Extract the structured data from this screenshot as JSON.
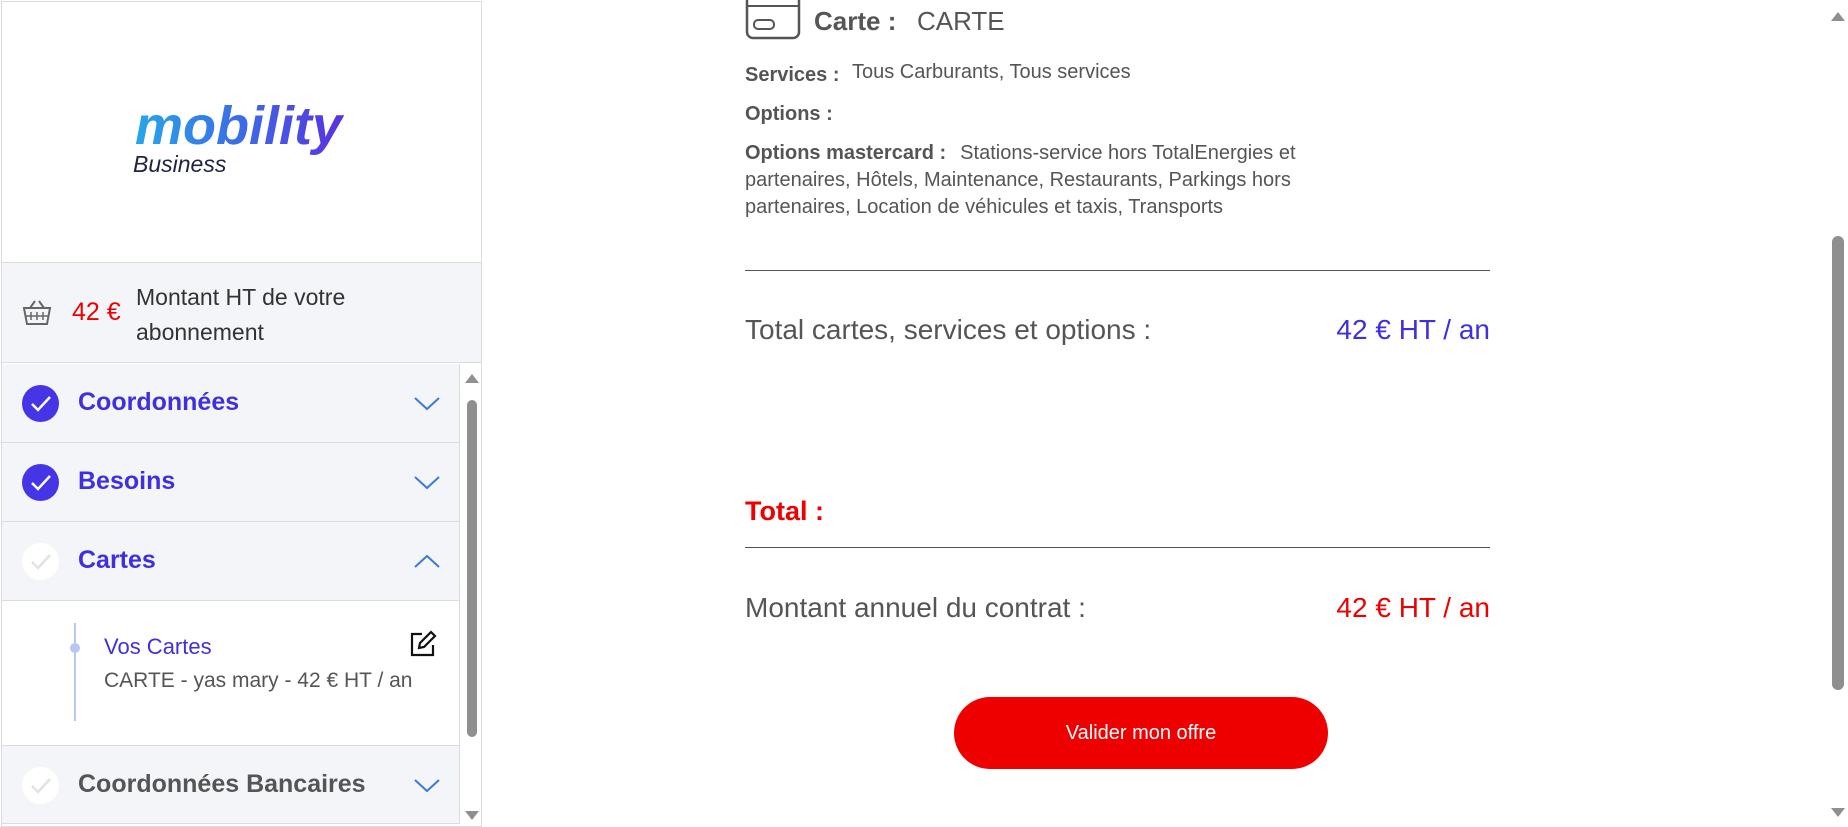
{
  "brand": {
    "logo_text_main": "mobility",
    "logo_text_sub": "Business"
  },
  "summary": {
    "amount": "42 €",
    "label": "Montant HT de votre abonnement"
  },
  "steps": [
    {
      "label": "Coordonnées",
      "status": "done",
      "expanded": false
    },
    {
      "label": "Besoins",
      "status": "done",
      "expanded": false
    },
    {
      "label": "Cartes",
      "status": "pending",
      "expanded": true
    },
    {
      "label": "Coordonnées Bancaires",
      "status": "pending",
      "expanded": false
    }
  ],
  "cards_section": {
    "title": "Vos Cartes",
    "detail": "CARTE - yas mary - 42 € HT / an"
  },
  "offer": {
    "card_label": "Carte :",
    "card_value": "CARTE",
    "services_label": "Services :",
    "services_value": "Tous Carburants, Tous services",
    "options_label": "Options :",
    "options_mc_label": "Options mastercard :",
    "options_mc_value": "Stations-service hors TotalEnergies et partenaires, Hôtels, Maintenance, Restaurants, Parkings hors partenaires, Location de véhicules et taxis, Transports",
    "subtotal_label": "Total cartes, services et options :",
    "subtotal_value": "42 € HT / an",
    "total_title": "Total :",
    "annual_label": "Montant annuel du contrat :",
    "annual_value": "42 € HT / an",
    "validate_button": "Valider mon offre"
  },
  "colors": {
    "accent": "#3f2fe0",
    "check_done": "#4535e6",
    "price_red": "#ee0000",
    "panel_bg": "#f4f5f8"
  },
  "icons": {
    "basket": "basket-icon",
    "check": "check-icon",
    "chevron_down": "chevron-down-icon",
    "chevron_up": "chevron-up-icon",
    "edit": "edit-icon",
    "card": "card-icon"
  }
}
